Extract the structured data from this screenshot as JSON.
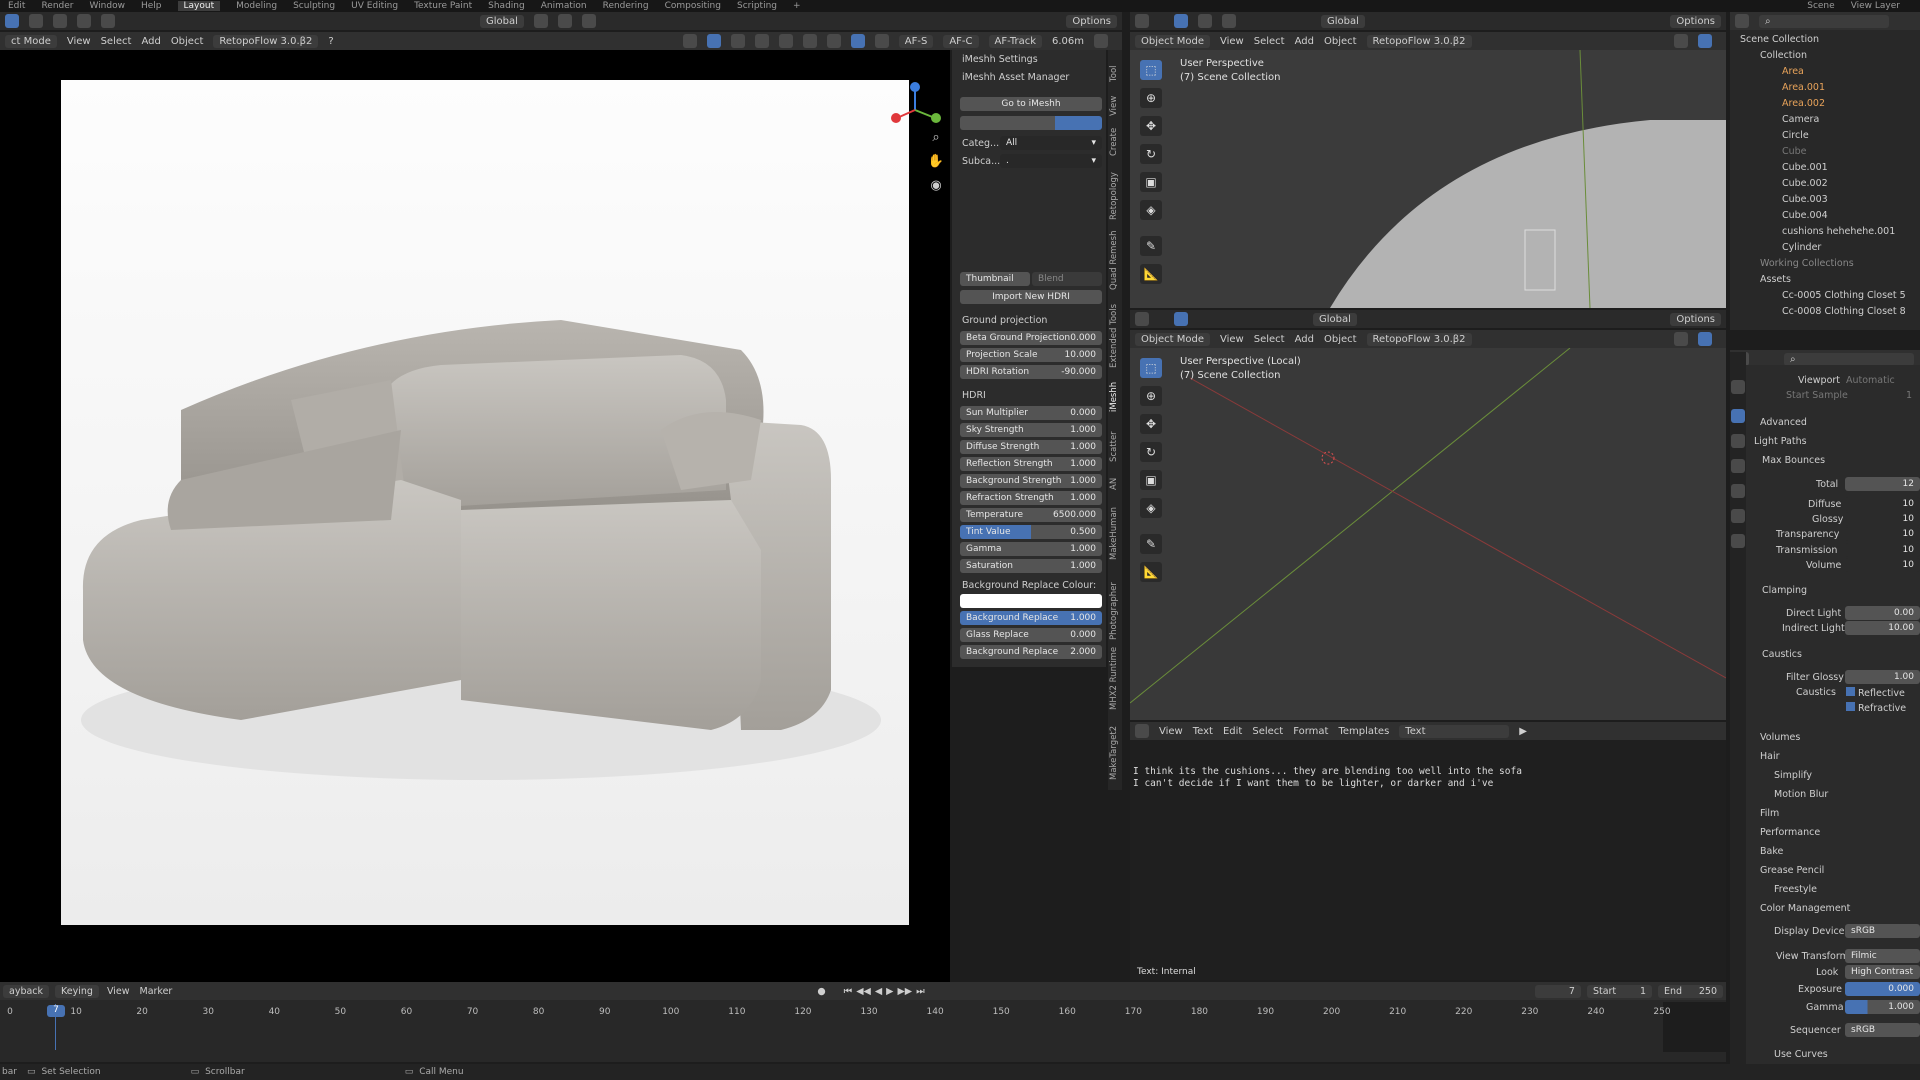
{
  "topbar": {
    "menus": [
      "Edit",
      "Render",
      "Window",
      "Help"
    ],
    "workspaces": [
      "Layout",
      "Modeling",
      "Sculpting",
      "UV Editing",
      "Texture Paint",
      "Shading",
      "Animation",
      "Rendering",
      "Compositing",
      "Scripting"
    ],
    "scene": "Scene",
    "view_layer": "View Layer"
  },
  "left_header": {
    "mode": "ct Mode",
    "menus": [
      "View",
      "Select",
      "Add",
      "Object"
    ],
    "addon": "RetopoFlow 3.0.β2",
    "transform": "Global",
    "af_s": "AF-S",
    "af_c": "AF-C",
    "af_track": "AF-Track",
    "distance": "6.06m",
    "options": "Options"
  },
  "npanel": {
    "imeshh_settings": "iMeshh Settings",
    "asset_manager": "iMeshh Asset Manager",
    "go_button": "Go to iMeshh",
    "categ_label": "Categ...",
    "categ_value": "All",
    "subca_label": "Subca...",
    "subca_value": ".",
    "thumbnail": "Thumbnail",
    "blend": "Blend",
    "import_hdri": "Import New HDRI",
    "ground_projection": "Ground projection",
    "beta_label": "Beta Ground Projection",
    "beta_value": "0.000",
    "proj_label": "Projection Scale",
    "proj_value": "10.000",
    "hrot_label": "HDRI Rotation",
    "hrot_value": "-90.000",
    "hdri_section": "HDRI",
    "sun_label": "Sun Multiplier",
    "sun_value": "0.000",
    "sky_label": "Sky Strength",
    "sky_value": "1.000",
    "diff_label": "Diffuse Strength",
    "diff_value": "1.000",
    "refl_label": "Reflection Strength",
    "refl_value": "1.000",
    "bg_label": "Background Strength",
    "bg_value": "1.000",
    "refr_label": "Refraction Strength",
    "refr_value": "1.000",
    "temp_label": "Temperature",
    "temp_value": "6500.000",
    "tint_label": "Tint Value",
    "tint_value": "0.500",
    "gamma_label": "Gamma",
    "gamma_value": "1.000",
    "sat_label": "Saturation",
    "sat_value": "1.000",
    "bg_replace_colour": "Background Replace Colour:",
    "bgr_label": "Background Replace",
    "bgr_value": "1.000",
    "glass_label": "Glass Replace",
    "glass_value": "0.000",
    "bgr2_label": "Background Replace",
    "bgr2_value": "2.000"
  },
  "side_tabs": [
    "Tool",
    "View",
    "Create",
    "Retopology",
    "Quad Remesh",
    "Extended Tools",
    "iMeshh",
    "Scatter",
    "AN",
    "MakeHuman",
    "Photographer",
    "MHX2 Runtime",
    "MakeTarget2"
  ],
  "top_viewport": {
    "mode": "Object Mode",
    "menus": [
      "View",
      "Select",
      "Add",
      "Object"
    ],
    "addon": "RetopoFlow 3.0.β2",
    "transform": "Global",
    "options": "Options",
    "title": "User Perspective",
    "collection": "(7) Scene Collection"
  },
  "mid_viewport": {
    "mode": "Object Mode",
    "menus": [
      "View",
      "Select",
      "Add",
      "Object"
    ],
    "addon": "RetopoFlow 3.0.β2",
    "transform": "Global",
    "options": "Options",
    "title": "User Perspective (Local)",
    "collection": "(7) Scene Collection"
  },
  "text_editor": {
    "menus": [
      "View",
      "Text",
      "Edit",
      "Select",
      "Format",
      "Templates"
    ],
    "file": "Text",
    "line1": "I think its the cushions... they are blending too well into the sofa",
    "line2": "I can't decide if I want them to be lighter, or darker and i've",
    "footer": "Text: Internal"
  },
  "outliner": {
    "root": "Scene Collection",
    "items": [
      "Collection",
      "Area",
      "Area.001",
      "Area.002",
      "Camera",
      "Circle",
      "Cube",
      "Cube.001",
      "Cube.002",
      "Cube.003",
      "Cube.004",
      "cushions hehehehe.001",
      "Cylinder",
      "Working Collections",
      "Assets",
      "Cc-0005 Clothing Closet 5",
      "Cc-0008 Clothing Closet 8"
    ]
  },
  "properties": {
    "viewport": "Viewport",
    "automatic": "Automatic",
    "start_sample": "Start Sample",
    "start_sample_value": "1",
    "advanced": "Advanced",
    "light_paths": "Light Paths",
    "max_bounces": "Max Bounces",
    "total": "Total",
    "total_v": "12",
    "diffuse": "Diffuse",
    "diffuse_v": "10",
    "glossy": "Glossy",
    "glossy_v": "10",
    "transparency": "Transparency",
    "transparency_v": "10",
    "transmission": "Transmission",
    "transmission_v": "10",
    "volume": "Volume",
    "volume_v": "10",
    "clamping": "Clamping",
    "direct": "Direct Light",
    "direct_v": "0.00",
    "indirect": "Indirect Light",
    "indirect_v": "10.00",
    "caustics": "Caustics",
    "filter_glossy": "Filter Glossy",
    "filter_glossy_v": "1.00",
    "caustics_label": "Caustics",
    "reflective": "Reflective",
    "refractive": "Refractive",
    "volumes": "Volumes",
    "hair": "Hair",
    "simplify": "Simplify",
    "motion_blur": "Motion Blur",
    "film": "Film",
    "performance": "Performance",
    "bake": "Bake",
    "grease_pencil": "Grease Pencil",
    "freestyle": "Freestyle",
    "color_mgmt": "Color Management",
    "display_device": "Display Device",
    "display_device_v": "sRGB",
    "view_transform": "View Transform",
    "view_transform_v": "Filmic",
    "look": "Look",
    "look_v": "High Contrast",
    "exposure": "Exposure",
    "exposure_v": "0.000",
    "gamma": "Gamma",
    "gamma_v": "1.000",
    "sequencer": "Sequencer",
    "sequencer_v": "sRGB",
    "use_curves": "Use Curves"
  },
  "timeline": {
    "menus": [
      "ayback",
      "Keying",
      "View",
      "Marker"
    ],
    "current_frame": "7",
    "start_label": "Start",
    "start": "1",
    "end_label": "End",
    "end": "250",
    "ticks": [
      "0",
      "10",
      "20",
      "30",
      "40",
      "50",
      "60",
      "70",
      "80",
      "90",
      "100",
      "110",
      "120",
      "130",
      "140",
      "150",
      "160",
      "170",
      "180",
      "190",
      "200",
      "210",
      "220",
      "230",
      "240",
      "250"
    ]
  },
  "status": {
    "select": "Set Selection",
    "scrollbar": "Scrollbar",
    "call_menu": "Call Menu",
    "bar": "bar"
  },
  "colors": {
    "accent": "#4772b3",
    "panel": "#2c2c2c",
    "viewport": "#3d3d3d"
  }
}
